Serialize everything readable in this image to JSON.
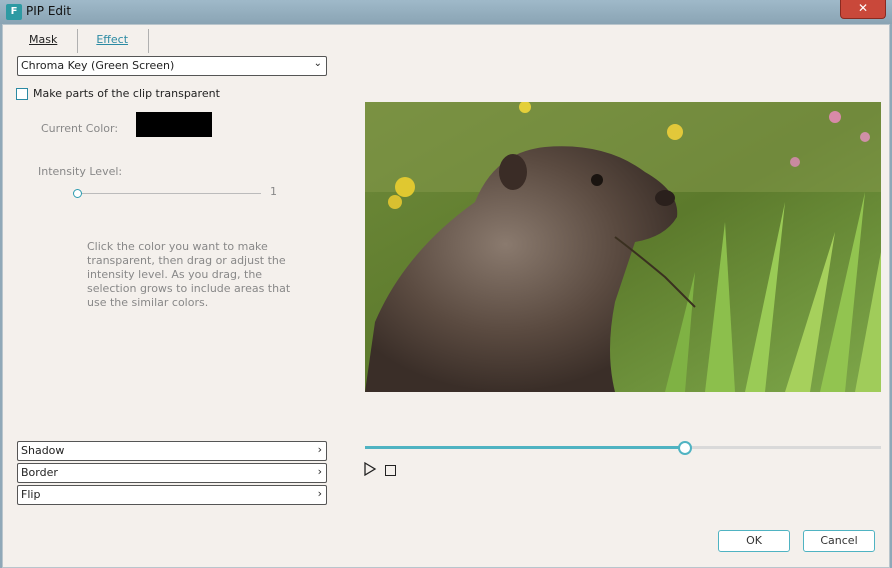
{
  "window": {
    "title": "PIP Edit",
    "app_icon_letter": "F",
    "close_symbol": "✕"
  },
  "tabs": [
    {
      "label": "Mask",
      "active": true
    },
    {
      "label": "Effect",
      "active": false
    }
  ],
  "effect_select": {
    "value": "Chroma Key (Green Screen)",
    "icon": "chevron-down-icon"
  },
  "transparent_checkbox": {
    "label": "Make parts of the clip transparent",
    "checked": false
  },
  "current_color": {
    "label": "Current Color:",
    "swatch_color": "#000000"
  },
  "intensity": {
    "label": "Intensity Level:",
    "value": "1"
  },
  "help_text": "Click the color you want to make transparent, then drag or adjust the intensity level. As you drag, the selection grows to include areas that use the similar colors.",
  "sections": [
    {
      "label": "Shadow"
    },
    {
      "label": "Border"
    },
    {
      "label": "Flip"
    }
  ],
  "preview": {
    "description_icon": "marmot-preview-image"
  },
  "timeline": {
    "progress": 0.62
  },
  "buttons": {
    "ok": "OK",
    "cancel": "Cancel"
  },
  "colors": {
    "accent": "#4fb3c2",
    "link": "#2b8aa3",
    "dialog_bg": "#f4f0ec"
  }
}
